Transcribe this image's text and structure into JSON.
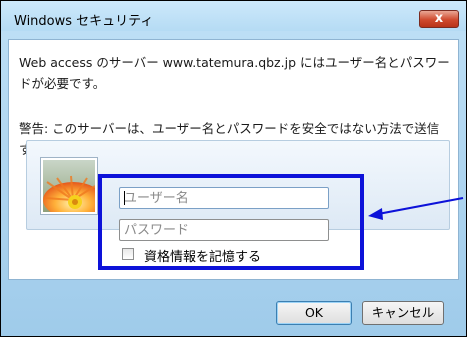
{
  "window": {
    "title": "Windows セキュリティ",
    "close_symbol": "x"
  },
  "message": {
    "line1": "Web access のサーバー www.tatemura.qbz.jp にはユーザー名とパスワードが必要です。",
    "warning": "警告: このサーバーは、ユーザー名とパスワードを安全ではない方法で送信することを要求しています (安全な接続を使わない基本的な認証)。"
  },
  "credentials": {
    "username_placeholder": "ユーザー名",
    "password_placeholder": "パスワード",
    "remember_label": "資格情報を記憶する",
    "remember_checked": false,
    "avatar_icon": "flower-user-tile-icon"
  },
  "annotation": {
    "color": "#0d12d9"
  },
  "buttons": {
    "ok": "OK",
    "cancel": "キャンセル"
  }
}
